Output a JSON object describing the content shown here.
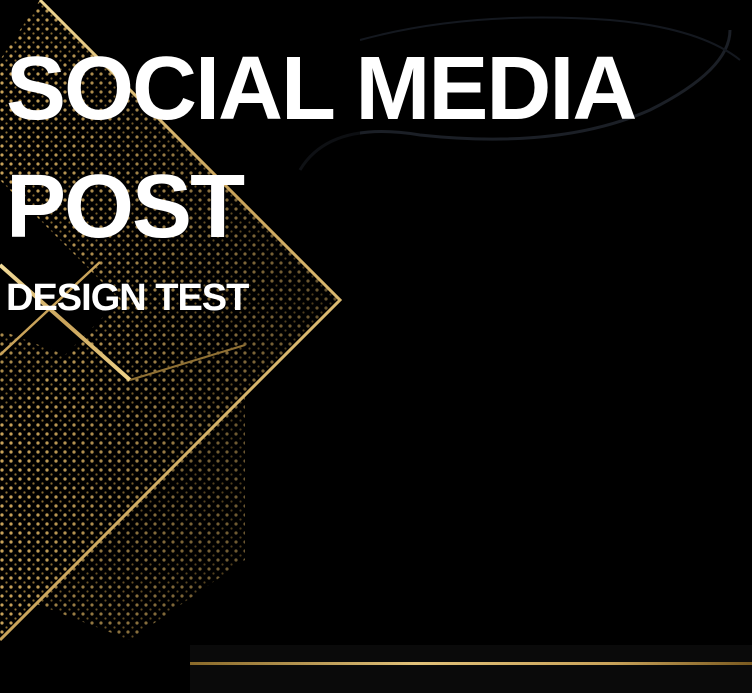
{
  "headline": {
    "line1": "SOCIAL MEDIA",
    "line2": "POST"
  },
  "subhead": "DESIGN TEST",
  "colors": {
    "background": "#000000",
    "gold": "#c9a35a",
    "gold_light": "#e8cd8a",
    "text": "#ffffff"
  }
}
